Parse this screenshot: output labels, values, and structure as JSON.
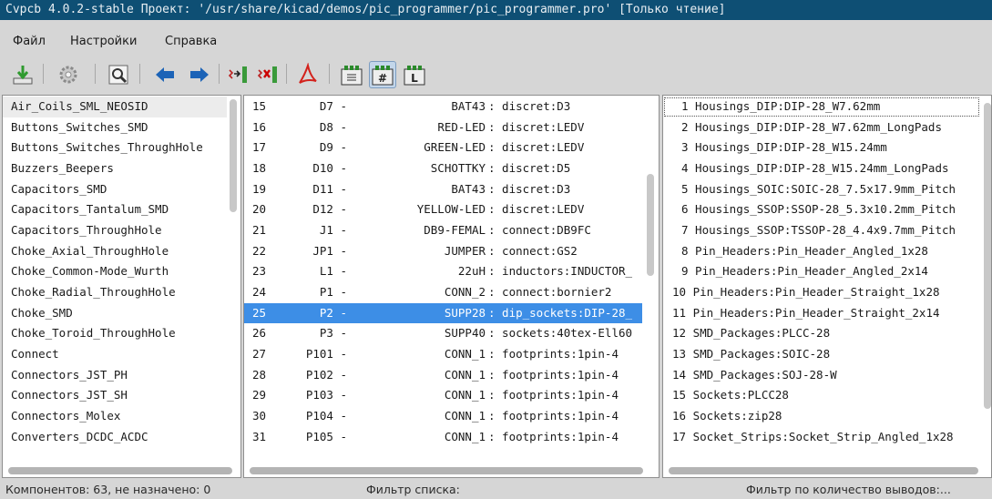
{
  "window": {
    "title": "Cvpcb 4.0.2-stable  Проект: '/usr/share/kicad/demos/pic_programmer/pic_programmer.pro' [Только чтение]"
  },
  "menu": {
    "file": "Файл",
    "settings": "Настройки",
    "help": "Справка"
  },
  "toolbar": {
    "icons": [
      "save-netlist-icon",
      "config-icon",
      "view-footprint-icon",
      "previous-component-arrow-icon",
      "next-component-arrow-icon",
      "auto-associate-icon",
      "delete-associations-icon",
      "pdf-doc-icon",
      "filter-by-keyword-icon",
      "filter-by-pin-count-icon",
      "filter-by-library-icon"
    ],
    "accent": "#1c63b7"
  },
  "libraries": [
    "Air_Coils_SML_NEOSID",
    "Buttons_Switches_SMD",
    "Buttons_Switches_ThroughHole",
    "Buzzers_Beepers",
    "Capacitors_SMD",
    "Capacitors_Tantalum_SMD",
    "Capacitors_ThroughHole",
    "Choke_Axial_ThroughHole",
    "Choke_Common-Mode_Wurth",
    "Choke_Radial_ThroughHole",
    "Choke_SMD",
    "Choke_Toroid_ThroughHole",
    "Connect",
    "Connectors_JST_PH",
    "Connectors_JST_SH",
    "Connectors_Molex",
    "Converters_DCDC_ACDC"
  ],
  "components": [
    {
      "num": "15",
      "ref": "D7 -",
      "value": "BAT43",
      "footprint": ": discret:D3"
    },
    {
      "num": "16",
      "ref": "D8 -",
      "value": "RED-LED",
      "footprint": ": discret:LEDV"
    },
    {
      "num": "17",
      "ref": "D9 -",
      "value": "GREEN-LED",
      "footprint": ": discret:LEDV"
    },
    {
      "num": "18",
      "ref": "D10 -",
      "value": "SCHOTTKY",
      "footprint": ": discret:D5"
    },
    {
      "num": "19",
      "ref": "D11 -",
      "value": "BAT43",
      "footprint": ": discret:D3"
    },
    {
      "num": "20",
      "ref": "D12 -",
      "value": "YELLOW-LED",
      "footprint": ": discret:LEDV"
    },
    {
      "num": "21",
      "ref": "J1 -",
      "value": "DB9-FEMAL",
      "footprint": ": connect:DB9FC"
    },
    {
      "num": "22",
      "ref": "JP1 -",
      "value": "JUMPER",
      "footprint": ": connect:GS2"
    },
    {
      "num": "23",
      "ref": "L1 -",
      "value": "22uH",
      "footprint": ": inductors:INDUCTOR_"
    },
    {
      "num": "24",
      "ref": "P1 -",
      "value": "CONN_2",
      "footprint": ": connect:bornier2"
    },
    {
      "num": "25",
      "ref": "P2 -",
      "value": "SUPP28",
      "footprint": ": dip_sockets:DIP-28_",
      "selected": true
    },
    {
      "num": "26",
      "ref": "P3 -",
      "value": "SUPP40",
      "footprint": ": sockets:40tex-Ell60"
    },
    {
      "num": "27",
      "ref": "P101 -",
      "value": "CONN_1",
      "footprint": ": footprints:1pin-4"
    },
    {
      "num": "28",
      "ref": "P102 -",
      "value": "CONN_1",
      "footprint": ": footprints:1pin-4"
    },
    {
      "num": "29",
      "ref": "P103 -",
      "value": "CONN_1",
      "footprint": ": footprints:1pin-4"
    },
    {
      "num": "30",
      "ref": "P104 -",
      "value": "CONN_1",
      "footprint": ": footprints:1pin-4"
    },
    {
      "num": "31",
      "ref": "P105 -",
      "value": "CONN_1",
      "footprint": ": footprints:1pin-4"
    }
  ],
  "footprints": [
    "1 Housings_DIP:DIP-28_W7.62mm",
    "2 Housings_DIP:DIP-28_W7.62mm_LongPads",
    "3 Housings_DIP:DIP-28_W15.24mm",
    "4 Housings_DIP:DIP-28_W15.24mm_LongPads",
    "5 Housings_SOIC:SOIC-28_7.5x17.9mm_Pitch",
    "6 Housings_SSOP:SSOP-28_5.3x10.2mm_Pitch",
    "7 Housings_SSOP:TSSOP-28_4.4x9.7mm_Pitch",
    "8 Pin_Headers:Pin_Header_Angled_1x28",
    "9 Pin_Headers:Pin_Header_Angled_2x14",
    "10 Pin_Headers:Pin_Header_Straight_1x28",
    "11 Pin_Headers:Pin_Header_Straight_2x14",
    "12 SMD_Packages:PLCC-28",
    "13 SMD_Packages:SOIC-28",
    "14 SMD_Packages:SOJ-28-W",
    "15 Sockets:PLCC28",
    "16 Sockets:zip28",
    "17 Socket_Strips:Socket_Strip_Angled_1x28"
  ],
  "status": {
    "components": "Компонентов: 63, не назначено: 0",
    "filter_list": "Фильтр списка:",
    "filter_pins": "Фильтр по количество выводов:..."
  },
  "colors": {
    "selection": "#3d8ee6",
    "title_bg": "#0e4f74"
  }
}
